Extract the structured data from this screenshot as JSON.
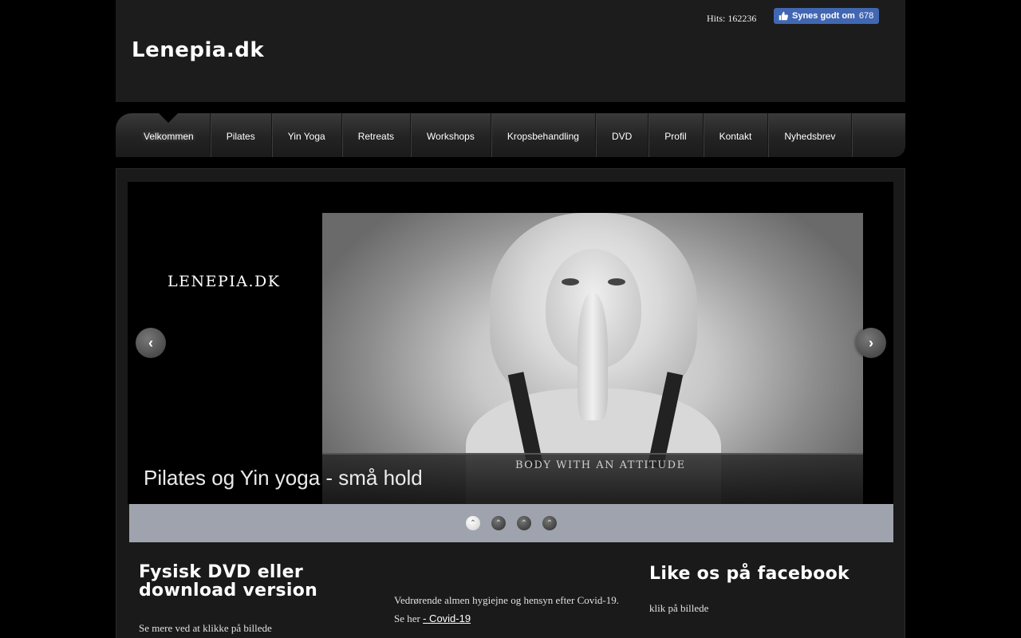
{
  "header": {
    "logo": "Lenepia.dk",
    "hits": "Hits: 162236",
    "fb_like": {
      "label": "Synes godt om",
      "count": "678"
    }
  },
  "nav": {
    "items": [
      {
        "label": "Velkommen"
      },
      {
        "label": "Pilates"
      },
      {
        "label": "Yin Yoga"
      },
      {
        "label": "Retreats"
      },
      {
        "label": "Workshops"
      },
      {
        "label": "Kropsbehandling"
      },
      {
        "label": "DVD"
      },
      {
        "label": "Profil"
      },
      {
        "label": "Kontakt"
      },
      {
        "label": "Nyhedsbrev"
      }
    ],
    "active_index": 0
  },
  "slider": {
    "logo_text": "LENEPIA.DK",
    "tagline": "BODY WITH AN ATTITUDE",
    "caption": "Pilates og Yin yoga - små hold",
    "prev_icon": "chevron-left-icon",
    "next_icon": "chevron-right-icon",
    "dots": 4,
    "active_dot": 0
  },
  "columns": {
    "dvd": {
      "title": "Fysisk DVD eller download version",
      "text": "Se mere ved at klikke på billede"
    },
    "covid": {
      "text": "Vedrørende almen hygiejne og hensyn efter Covid-19.",
      "link_prefix": "Se her",
      "link_text": " - Covid-19"
    },
    "facebook": {
      "title": "Like os på facebook",
      "text": "klik på billede"
    }
  },
  "colors": {
    "page_bg": "#000000",
    "panel_bg": "#1a1a1a",
    "fb_blue": "#4267b2",
    "dots_bar": "#9fa3ad"
  }
}
